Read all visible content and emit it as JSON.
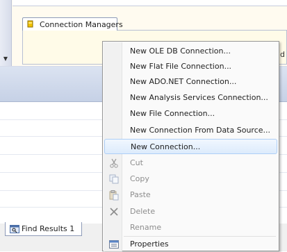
{
  "tabs": {
    "connection_managers": "Connection Managers",
    "find_results": "Find Results 1"
  },
  "connection_pane": {
    "overflow_text": "dd"
  },
  "context_menu": {
    "items": [
      {
        "label": "New OLE DB Connection...",
        "enabled": true
      },
      {
        "label": "New Flat File Connection...",
        "enabled": true
      },
      {
        "label": "New ADO.NET Connection...",
        "enabled": true
      },
      {
        "label": "New Analysis Services Connection...",
        "enabled": true
      },
      {
        "label": "New File Connection...",
        "enabled": true
      },
      {
        "label": "New Connection From Data Source...",
        "enabled": true
      },
      {
        "label": "New Connection...",
        "enabled": true,
        "highlighted": true
      },
      {
        "label": "Cut",
        "enabled": false,
        "icon": "scissors-icon"
      },
      {
        "label": "Copy",
        "enabled": false,
        "icon": "copy-icon"
      },
      {
        "label": "Paste",
        "enabled": false,
        "icon": "paste-icon"
      },
      {
        "label": "Delete",
        "enabled": false,
        "icon": "delete-x-icon"
      },
      {
        "label": "Rename",
        "enabled": false
      },
      {
        "label": "Properties",
        "enabled": true,
        "icon": "properties-icon"
      }
    ]
  },
  "colors": {
    "highlight_border": "#aecff7",
    "menu_background": "#fafafa",
    "disabled_text": "#8d8d8d"
  }
}
